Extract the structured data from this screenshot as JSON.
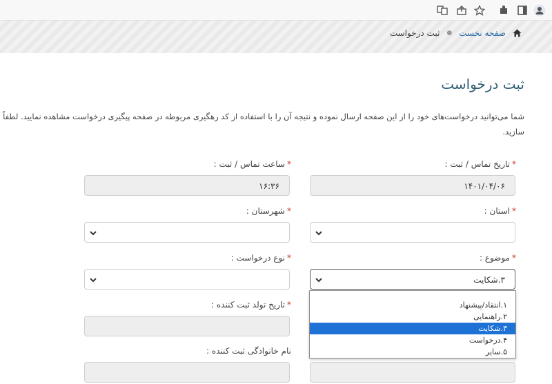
{
  "browser": {
    "icons": [
      "translate-icon",
      "share-icon",
      "star-icon",
      "extensions-icon",
      "sidebar-icon",
      "profile-icon"
    ]
  },
  "breadcrumb": {
    "home": "صفحه نخست",
    "current": "ثبت درخواست"
  },
  "page": {
    "title": "ثبت درخواست",
    "intro_line1": "شما می‌توانید درخواست‌های خود را از این صفحه ارسال نموده و نتیجه آن را با استفاده از کد رهگیری مربوطه در صفحه پیگیری درخواست مشاهده نمایید. لطفاً ما را از نظ",
    "intro_line2": "سازید."
  },
  "form": {
    "contact_date": {
      "label": "تاریخ تماس / ثبت :",
      "value": "۱۴۰۱/۰۴/۰۶"
    },
    "contact_time": {
      "label": "ساعت تماس / ثبت :",
      "value": "۱۶:۳۶"
    },
    "province": {
      "label": "استان :",
      "value": ""
    },
    "city": {
      "label": "شهرستان :",
      "value": ""
    },
    "subject": {
      "label": "موضوع :",
      "value": "۳.شکایت"
    },
    "request_type": {
      "label": "نوع درخواست :",
      "value": ""
    },
    "birth_date": {
      "label": "تاریخ تولد ثبت کننده :",
      "value": ""
    },
    "family_name": {
      "label": "نام خانوادگی ثبت کننده :",
      "value": ""
    }
  },
  "subject_options": [
    "۱.انتقاد/پیشنهاد",
    "۲.راهنمایی",
    "۳.شکایت",
    "۴.درخواست",
    "۵.سایر"
  ],
  "subject_selected_index": 2,
  "colors": {
    "title": "#2e5d74",
    "link": "#2f6aa8",
    "required": "#c0392b",
    "selected": "#1e72d6"
  }
}
